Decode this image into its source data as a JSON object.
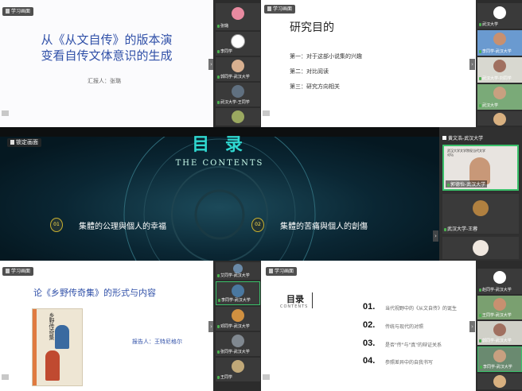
{
  "panel_top_left": {
    "chip": "学习画面",
    "title_line1": "从《从文自传》的版本演",
    "title_line2": "变看自传文体意识的生成",
    "reporter": "汇报人：张璐",
    "tiles": [
      "张璐",
      "李同学",
      "郭同学-武汉大学",
      "武汉大学-王同学"
    ]
  },
  "panel_top_right": {
    "chip": "学习画面",
    "title": "研究目的",
    "points": [
      "第一：对于这部小说集的兴趣",
      "第二：对比阅读",
      "第三：研究方向相关"
    ],
    "tiles": [
      "武汉大学",
      "李同学-武汉大学",
      "武汉大学-刘同学",
      "武汉大学"
    ]
  },
  "panel_middle": {
    "chip": "锁定画面",
    "heading": "目 录",
    "subheading": "THE CONTENTS",
    "item1_num": "01",
    "item1": "集體的公理與個人的幸福",
    "item2_num": "02",
    "item2": "集體的苦痛與個人的創傷",
    "slide_tile_title": "武汉大学文学院现当代文学论坛",
    "tiles": [
      "郭德怡-武汉大学",
      "武汉大学-王蓉"
    ],
    "top_tile": "黄文浩-武汉大学"
  },
  "panel_bottom_left": {
    "chip": "学习画面",
    "title": "论《乡野传奇集》的形式与内容",
    "reporter": "报告人：王特尼格尔",
    "book_title": "乡野传奇集",
    "tiles": [
      "艾同学-武汉大学",
      "李同学-武汉大学",
      "邓同学-武汉大学",
      "张同学-武汉大学",
      "王同学"
    ]
  },
  "panel_bottom_right": {
    "chip": "学习画面",
    "heading": "目录",
    "subheading": "CONTENTS",
    "items": [
      {
        "num": "01.",
        "text": "当代视野中的《从文自传》的诞生"
      },
      {
        "num": "02.",
        "text": "传统与现代的对照"
      },
      {
        "num": "03.",
        "text": "是否\"传\"与\"真\"的辩证关系"
      },
      {
        "num": "04.",
        "text": "参照差异中的自我书写"
      }
    ],
    "tiles": [
      "赵同学-武汉大学",
      "王同学-武汉大学",
      "郭同学-武汉大学",
      "李同学-武汉大学"
    ]
  }
}
